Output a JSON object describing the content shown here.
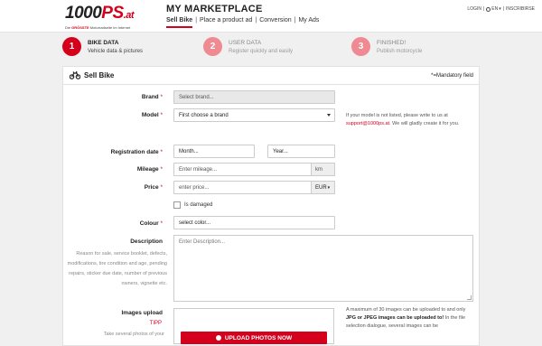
{
  "header": {
    "logo_main_a": "1000",
    "logo_main_b": "PS",
    "logo_main_c": ".at",
    "logo_sub_a": "Die ",
    "logo_sub_b": "GRÖSSTE",
    "logo_sub_c": " Motorradseite im Internet",
    "title": "MY MARKETPLACE",
    "nav": [
      "Sell Bike",
      "Place a product ad",
      "Conversion",
      "My Ads"
    ],
    "login": "LOGIN",
    "lang": "EN",
    "register": "INSCRIBIRSE"
  },
  "steps": [
    {
      "num": "1",
      "title": "BIKE DATA",
      "sub": "Vehicle data & pictures"
    },
    {
      "num": "2",
      "title": "USER DATA",
      "sub": "Register quickly and easily"
    },
    {
      "num": "3",
      "title": "FINISHED!",
      "sub": "Publish motorcycle"
    }
  ],
  "panel": {
    "title": "Sell Bike",
    "mandatory": "*=Mandatory field"
  },
  "form": {
    "brand_label": "Brand",
    "brand_value": "Select brand...",
    "model_label": "Model",
    "model_value": "First choose a brand",
    "model_hint_a": "If your model is not listed, please write to us at ",
    "model_hint_email": "support@1000ps.at",
    "model_hint_b": ". We will gladly create it for you.",
    "reg_label": "Registration date",
    "month_value": "Month...",
    "year_value": "Year...",
    "mileage_label": "Mileage",
    "mileage_placeholder": "Enter mileage...",
    "mileage_unit": "km",
    "price_label": "Price",
    "price_placeholder": "enter price...",
    "currency": "EUR",
    "damaged_label": "Is damaged",
    "colour_label": "Colour",
    "colour_value": "select color...",
    "desc_label": "Description",
    "desc_placeholder": "Enter Description...",
    "desc_help": "Reason for sale, service booklet, defects, modifications, tire condition and age, pending repairs, sticker due date, number of previous owners, vignette etc.",
    "images_label": "Images upload",
    "tipp": "TIPP",
    "tip_text": "Take several photos of your",
    "upload_button": "UPLOAD PHOTOS NOW",
    "images_hint_a": "A maximum of 30 images can be uploaded to and only ",
    "images_hint_bold": "JPG or JPEG images can be uploaded to!",
    "images_hint_b": " In the file selection dialogue, several images can be"
  },
  "colors": {
    "accent": "#d4001c",
    "accent_light": "#ef8a93"
  }
}
